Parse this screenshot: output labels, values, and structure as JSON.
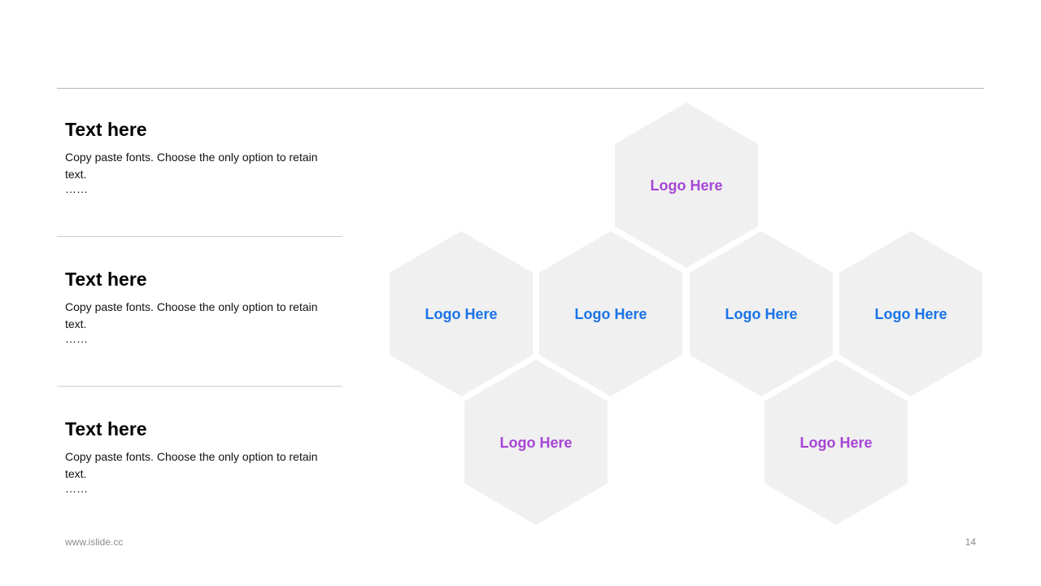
{
  "blocks": [
    {
      "title": "Text here",
      "body": "Copy paste fonts. Choose the only option to retain text.",
      "ellipsis": "……"
    },
    {
      "title": "Text here",
      "body": "Copy paste fonts. Choose the only option to retain text.",
      "ellipsis": "……"
    },
    {
      "title": "Text here",
      "body": "Copy paste fonts. Choose the only option to retain text.",
      "ellipsis": "……"
    }
  ],
  "logos": [
    {
      "label": "Logo Here",
      "color": "#a646d6"
    },
    {
      "label": "Logo Here",
      "color": "#1a73e8"
    },
    {
      "label": "Logo Here",
      "color": "#1a73e8"
    },
    {
      "label": "Logo Here",
      "color": "#1a73e8"
    },
    {
      "label": "Logo Here",
      "color": "#1a73e8"
    },
    {
      "label": "Logo Here",
      "color": "#a646d6"
    },
    {
      "label": "Logo Here",
      "color": "#a646d6"
    }
  ],
  "footer": {
    "url": "www.islide.cc",
    "page": "14"
  }
}
